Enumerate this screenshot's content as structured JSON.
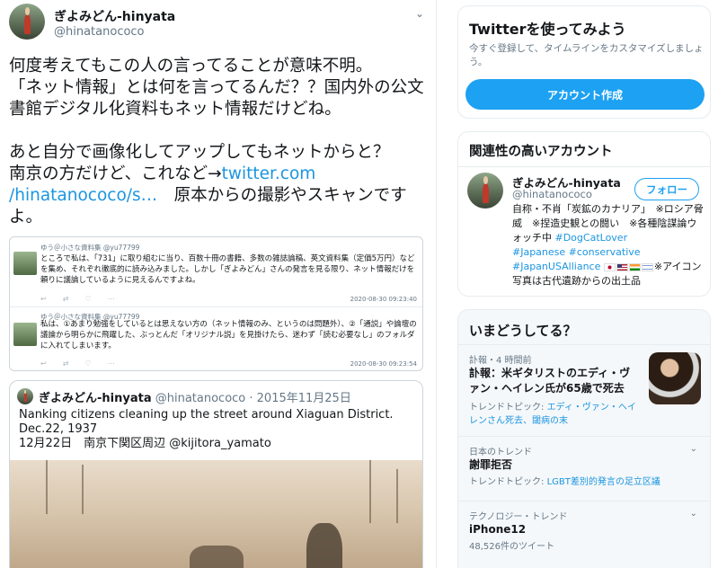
{
  "tweet": {
    "author_name": "ぎよみどん-hinyata",
    "author_handle": "@hinatanococo",
    "text_before_link": "何度考えてもこの人の言ってることが意味不明。\n「ネット情報」とは何を言ってるんだ？？国内外の公文書館デジタル化資料もネット情報だけどね。\n\nあと自分で画像化してアップしてもネットからと？\n南京の方だけど、これなど→",
    "link": "twitter.com\n/hinatanococo/s…",
    "text_after_link": "　原本からの撮影やスキャンですよ。"
  },
  "embedded_image": {
    "tweets": [
      {
        "name": "ゆう＠小さな資料集 @yu77799",
        "body": "ところで私は、「731」に取り組むに当り、百数十冊の書籍、多数の雑誌論稿、英文資料集（定価5万円）などを集め、それぞれ徹底的に読み込みました。しかし「ぎよみどん」さんの発言を見る限り、ネット情報だけを頼りに議論しているように見えるんですよね。",
        "time": "2020-08-30 09:23:40"
      },
      {
        "name": "ゆう＠小さな資料集 @yu77799",
        "body": "私は、①あまり勉強をしているとは思えない方の（ネット情報のみ、というのは問題外）、②「通説」や論壇の議論から明らかに飛躍した、ぶっとんだ「オリジナル説」を見掛けたら、迷わず「読む必要なし」のフォルダに入れてしまいます。",
        "time": "2020-08-30 09:23:54"
      }
    ]
  },
  "quoted": {
    "name": "ぎよみどん-hinyata",
    "meta": " @hinatanococo · 2015年11月25日",
    "text": "Nanking citizens cleaning up the street around Xiaguan District.\nDec.22, 1937\n12月22日　南京下関区周辺 @kijitora_yamato"
  },
  "signup": {
    "title": "Twitterを使ってみよう",
    "description": "今すぐ登録して、タイムラインをカスタマイズしましょう。",
    "button_label": "アカウント作成"
  },
  "related": {
    "title": "関連性の高いアカウント",
    "name": "ぎよみどん-hinyata",
    "handle": "@hinatanococo",
    "follow_label": "フォロー",
    "bio_1": "自称・不肖「炭鉱のカナリア」　※ロシア脅威　※捏造史観との闘い　※各種陰謀論ウォッチ中 ",
    "bio_tag_1": "#DogCatLover",
    "bio_tag_2": "#Japanese",
    "bio_tag_3": "#conservative",
    "bio_tag_4": "#JapanUSAlliance",
    "bio_2": "※アイコン写真は古代遺跡からの出土品"
  },
  "trends": {
    "title": "いまどうしてる？",
    "items": [
      {
        "context": "訃報・4 時間前",
        "title": "訃報：米ギタリストのエディ・ヴァン・ヘイレン氏が65歳で死去",
        "sub_prefix": "トレンドトピック: ",
        "sub_tags": "エディ・ヴァン・ヘイレンさん死去、閾病の末"
      },
      {
        "context": "日本のトレンド",
        "title": "謝罪拒否",
        "sub_prefix": "トレンドトピック: ",
        "sub_tags": "LGBT差別的発言の足立区議"
      },
      {
        "context": "テクノロジー・トレンド",
        "title": "iPhone12",
        "sub": "48,526件のツイート"
      }
    ]
  }
}
